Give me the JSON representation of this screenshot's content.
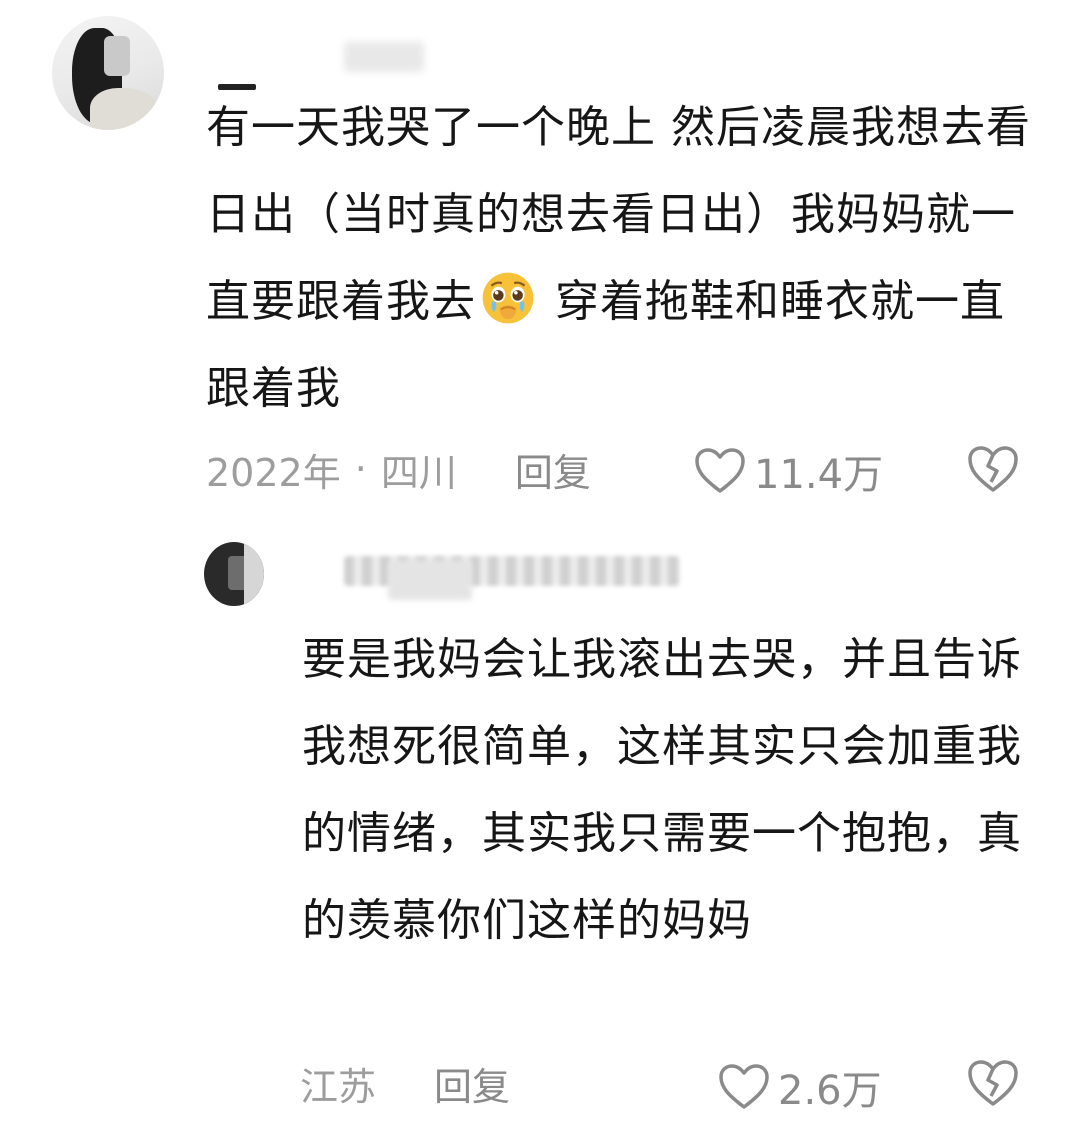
{
  "comment": {
    "text_before_emoji": "有一天我哭了一个晚上 然后凌晨我想去看日出（当时真的想去看日出）我妈妈就一直要跟着我去",
    "emoji": "pleading-crying-face-emoji",
    "text_after_emoji": " 穿着拖鞋和睡衣就一直跟着我",
    "date": "2022年",
    "separator": "·",
    "location": "四川",
    "reply_label": "回复",
    "like_count": "11.4万"
  },
  "reply": {
    "text": "要是我妈会让我滚出去哭，并且告诉我想死很简单，这样其实只会加重我的情绪，其实我只需要一个抱抱，真的羡慕你们这样的妈妈",
    "location": "江苏",
    "reply_label": "回复",
    "like_count": "2.6万"
  },
  "icons": {
    "like": "heart-outline-icon",
    "dislike": "broken-heart-icon"
  },
  "colors": {
    "text": "#161616",
    "meta": "#9d9d9d",
    "icon": "#8a8a8a",
    "emoji_face": "#f7c23a"
  }
}
